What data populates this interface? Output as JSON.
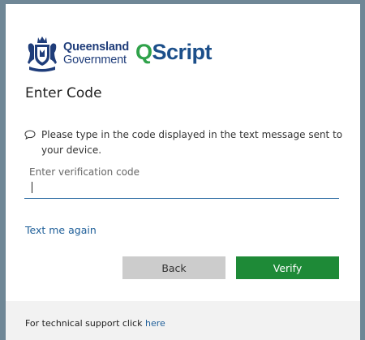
{
  "branding": {
    "gov_line1": "Queensland",
    "gov_line2": "Government",
    "product_q": "Q",
    "product_rest": "Script"
  },
  "page": {
    "title": "Enter Code",
    "message": "Please type in the code displayed in the text message sent to your device."
  },
  "form": {
    "code_label": "Enter verification code",
    "code_value": "",
    "resend_link": "Text me again",
    "back_label": "Back",
    "verify_label": "Verify"
  },
  "footer": {
    "support_text": "For technical support click ",
    "support_link": "here"
  },
  "colors": {
    "backdrop": "#6f8796",
    "brand_blue": "#1f3d7a",
    "qscript_green": "#2fa24a",
    "verify_green": "#1e8a37",
    "link_blue": "#1f5f99"
  }
}
